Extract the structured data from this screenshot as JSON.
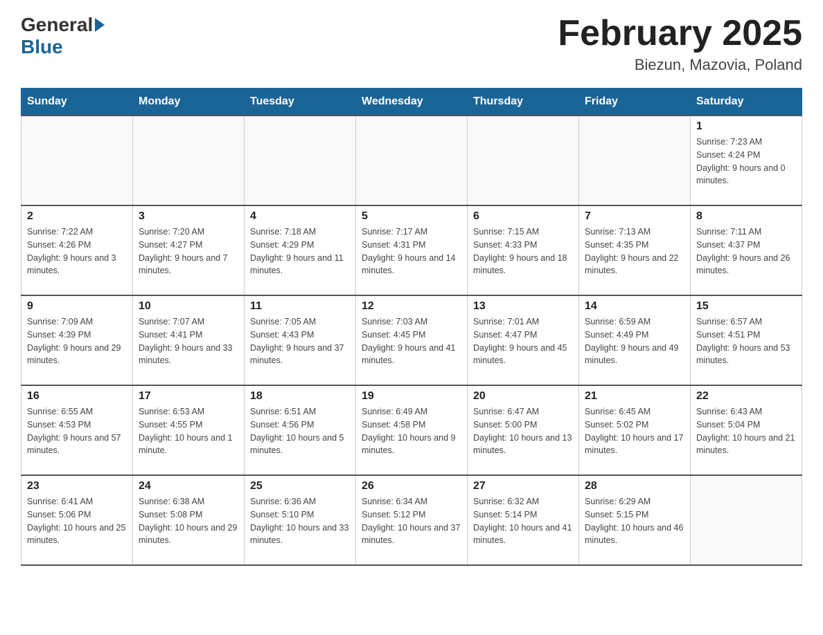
{
  "header": {
    "logo_general": "General",
    "logo_blue": "Blue",
    "month_title": "February 2025",
    "location": "Biezun, Mazovia, Poland"
  },
  "weekdays": [
    "Sunday",
    "Monday",
    "Tuesday",
    "Wednesday",
    "Thursday",
    "Friday",
    "Saturday"
  ],
  "weeks": [
    [
      {
        "day": "",
        "info": ""
      },
      {
        "day": "",
        "info": ""
      },
      {
        "day": "",
        "info": ""
      },
      {
        "day": "",
        "info": ""
      },
      {
        "day": "",
        "info": ""
      },
      {
        "day": "",
        "info": ""
      },
      {
        "day": "1",
        "info": "Sunrise: 7:23 AM\nSunset: 4:24 PM\nDaylight: 9 hours and 0 minutes."
      }
    ],
    [
      {
        "day": "2",
        "info": "Sunrise: 7:22 AM\nSunset: 4:26 PM\nDaylight: 9 hours and 3 minutes."
      },
      {
        "day": "3",
        "info": "Sunrise: 7:20 AM\nSunset: 4:27 PM\nDaylight: 9 hours and 7 minutes."
      },
      {
        "day": "4",
        "info": "Sunrise: 7:18 AM\nSunset: 4:29 PM\nDaylight: 9 hours and 11 minutes."
      },
      {
        "day": "5",
        "info": "Sunrise: 7:17 AM\nSunset: 4:31 PM\nDaylight: 9 hours and 14 minutes."
      },
      {
        "day": "6",
        "info": "Sunrise: 7:15 AM\nSunset: 4:33 PM\nDaylight: 9 hours and 18 minutes."
      },
      {
        "day": "7",
        "info": "Sunrise: 7:13 AM\nSunset: 4:35 PM\nDaylight: 9 hours and 22 minutes."
      },
      {
        "day": "8",
        "info": "Sunrise: 7:11 AM\nSunset: 4:37 PM\nDaylight: 9 hours and 26 minutes."
      }
    ],
    [
      {
        "day": "9",
        "info": "Sunrise: 7:09 AM\nSunset: 4:39 PM\nDaylight: 9 hours and 29 minutes."
      },
      {
        "day": "10",
        "info": "Sunrise: 7:07 AM\nSunset: 4:41 PM\nDaylight: 9 hours and 33 minutes."
      },
      {
        "day": "11",
        "info": "Sunrise: 7:05 AM\nSunset: 4:43 PM\nDaylight: 9 hours and 37 minutes."
      },
      {
        "day": "12",
        "info": "Sunrise: 7:03 AM\nSunset: 4:45 PM\nDaylight: 9 hours and 41 minutes."
      },
      {
        "day": "13",
        "info": "Sunrise: 7:01 AM\nSunset: 4:47 PM\nDaylight: 9 hours and 45 minutes."
      },
      {
        "day": "14",
        "info": "Sunrise: 6:59 AM\nSunset: 4:49 PM\nDaylight: 9 hours and 49 minutes."
      },
      {
        "day": "15",
        "info": "Sunrise: 6:57 AM\nSunset: 4:51 PM\nDaylight: 9 hours and 53 minutes."
      }
    ],
    [
      {
        "day": "16",
        "info": "Sunrise: 6:55 AM\nSunset: 4:53 PM\nDaylight: 9 hours and 57 minutes."
      },
      {
        "day": "17",
        "info": "Sunrise: 6:53 AM\nSunset: 4:55 PM\nDaylight: 10 hours and 1 minute."
      },
      {
        "day": "18",
        "info": "Sunrise: 6:51 AM\nSunset: 4:56 PM\nDaylight: 10 hours and 5 minutes."
      },
      {
        "day": "19",
        "info": "Sunrise: 6:49 AM\nSunset: 4:58 PM\nDaylight: 10 hours and 9 minutes."
      },
      {
        "day": "20",
        "info": "Sunrise: 6:47 AM\nSunset: 5:00 PM\nDaylight: 10 hours and 13 minutes."
      },
      {
        "day": "21",
        "info": "Sunrise: 6:45 AM\nSunset: 5:02 PM\nDaylight: 10 hours and 17 minutes."
      },
      {
        "day": "22",
        "info": "Sunrise: 6:43 AM\nSunset: 5:04 PM\nDaylight: 10 hours and 21 minutes."
      }
    ],
    [
      {
        "day": "23",
        "info": "Sunrise: 6:41 AM\nSunset: 5:06 PM\nDaylight: 10 hours and 25 minutes."
      },
      {
        "day": "24",
        "info": "Sunrise: 6:38 AM\nSunset: 5:08 PM\nDaylight: 10 hours and 29 minutes."
      },
      {
        "day": "25",
        "info": "Sunrise: 6:36 AM\nSunset: 5:10 PM\nDaylight: 10 hours and 33 minutes."
      },
      {
        "day": "26",
        "info": "Sunrise: 6:34 AM\nSunset: 5:12 PM\nDaylight: 10 hours and 37 minutes."
      },
      {
        "day": "27",
        "info": "Sunrise: 6:32 AM\nSunset: 5:14 PM\nDaylight: 10 hours and 41 minutes."
      },
      {
        "day": "28",
        "info": "Sunrise: 6:29 AM\nSunset: 5:15 PM\nDaylight: 10 hours and 46 minutes."
      },
      {
        "day": "",
        "info": ""
      }
    ]
  ]
}
